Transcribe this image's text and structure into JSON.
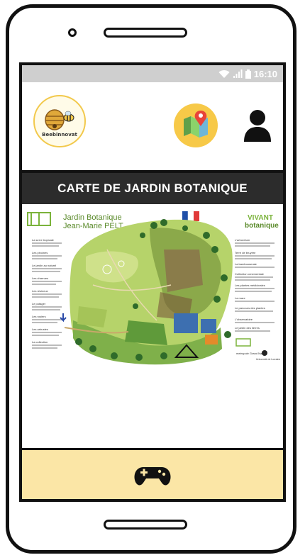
{
  "status_bar": {
    "time": "16:10",
    "icons": [
      "wifi-icon",
      "signal-icon",
      "battery-icon"
    ]
  },
  "header": {
    "logo_text": "Beebinnovat",
    "map_button_icon": "map-icon",
    "user_button_icon": "user-icon"
  },
  "page_title": "CARTE DE JARDIN BOTANIQUE",
  "map_panel": {
    "title_line1": "Jardin Botanique",
    "title_line2": "Jean-Marie PELT",
    "right_logo_line1": "VIVANT",
    "right_logo_line2": "botanique",
    "left_legend_items": [
      "La serre tropicale",
      "Les pivoines",
      "Le jardin au naturel",
      "Les charrues",
      "Les résineux",
      "Le potager",
      "Les rosiers",
      "Les arbustes",
      "La collection"
    ],
    "right_legend_items": [
      "L'arboretum",
      "Terre de bruyère",
      "La bambouseraie",
      "Collection ornementale",
      "Les plantes médicinales",
      "La mare",
      "Le parcours des plantes",
      "L'observatoire",
      "Le jardin des lierres"
    ],
    "footer_logos": [
      "metropole Grand Nancy",
      "Université de Lorraine"
    ],
    "flag": "french-flag"
  },
  "bottom_bar": {
    "icon": "gamepad-icon"
  },
  "colors": {
    "title_bar_bg": "#2c2c2c",
    "bottom_bar_bg": "#fbe6a6",
    "status_bar_bg": "#cfcfcf",
    "map_button_bg": "#f7c948"
  }
}
